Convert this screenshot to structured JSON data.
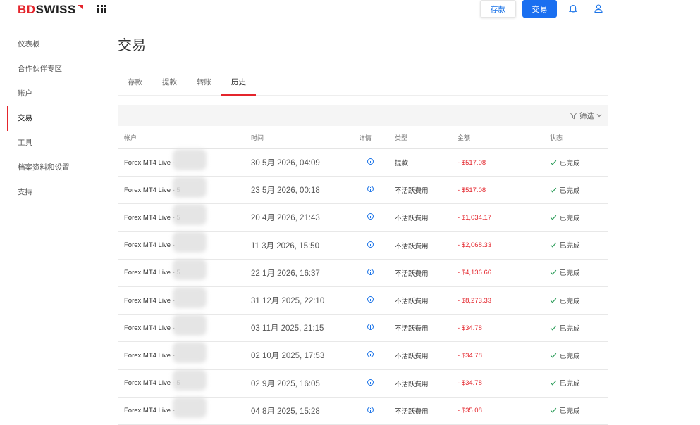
{
  "header": {
    "logo_bd": "BD",
    "logo_swiss": "SWISS",
    "deposit_label": "存款",
    "trade_label": "交易"
  },
  "sidebar": {
    "items": [
      {
        "label": "仪表板"
      },
      {
        "label": "合作伙伴专区"
      },
      {
        "label": "账户"
      },
      {
        "label": "交易",
        "active": true
      },
      {
        "label": "工具"
      },
      {
        "label": "档案资料和设置"
      },
      {
        "label": "支持"
      }
    ]
  },
  "page": {
    "title": "交易"
  },
  "tabs": [
    {
      "label": "存款"
    },
    {
      "label": "提款"
    },
    {
      "label": "转账"
    },
    {
      "label": "历史",
      "active": true
    }
  ],
  "filter": {
    "label": "筛选"
  },
  "table": {
    "headers": {
      "account": "帐户",
      "time": "时间",
      "details": "详情",
      "type": "类型",
      "amount": "金额",
      "status": "状态"
    },
    "rows": [
      {
        "account": "Forex MT4 Live - ",
        "time": "30 5月 2026, 04:09",
        "type": "提款",
        "amount": "- $517.08",
        "status": "已完成"
      },
      {
        "account": "Forex MT4 Live - 5",
        "time": "23 5月 2026, 00:18",
        "type": "不活跃费用",
        "amount": "- $517.08",
        "status": "已完成"
      },
      {
        "account": "Forex MT4 Live - 5",
        "time": "20 4月 2026, 21:43",
        "type": "不活跃费用",
        "amount": "- $1,034.17",
        "status": "已完成"
      },
      {
        "account": "Forex MT4 Live - ",
        "time": "11 3月 2026, 15:50",
        "type": "不活跃费用",
        "amount": "- $2,068.33",
        "status": "已完成"
      },
      {
        "account": "Forex MT4 Live - 5",
        "time": "22 1月 2026, 16:37",
        "type": "不活跃费用",
        "amount": "- $4,136.66",
        "status": "已完成"
      },
      {
        "account": "Forex MT4 Live - ",
        "time": "31 12月 2025, 22:10",
        "type": "不活跃费用",
        "amount": "- $8,273.33",
        "status": "已完成"
      },
      {
        "account": "Forex MT4 Live - ",
        "time": "03 11月 2025, 21:15",
        "type": "不活跃费用",
        "amount": "- $34.78",
        "status": "已完成"
      },
      {
        "account": "Forex MT4 Live - ",
        "time": "02 10月 2025, 17:53",
        "type": "不活跃费用",
        "amount": "- $34.78",
        "status": "已完成"
      },
      {
        "account": "Forex MT4 Live - 5",
        "time": "02 9月 2025, 16:05",
        "type": "不活跃费用",
        "amount": "- $34.78",
        "status": "已完成"
      },
      {
        "account": "Forex MT4 Live - ",
        "time": "04 8月 2025, 15:28",
        "type": "不活跃费用",
        "amount": "- $35.08",
        "status": "已完成"
      }
    ]
  },
  "colors": {
    "brand_red": "#e4252c",
    "primary_blue": "#1a6ff0",
    "status_green": "#2e9e5b"
  },
  "icons": [
    "apps-grid-icon",
    "bell-icon",
    "user-icon",
    "filter-icon",
    "chevron-down-icon",
    "info-icon",
    "check-icon"
  ]
}
